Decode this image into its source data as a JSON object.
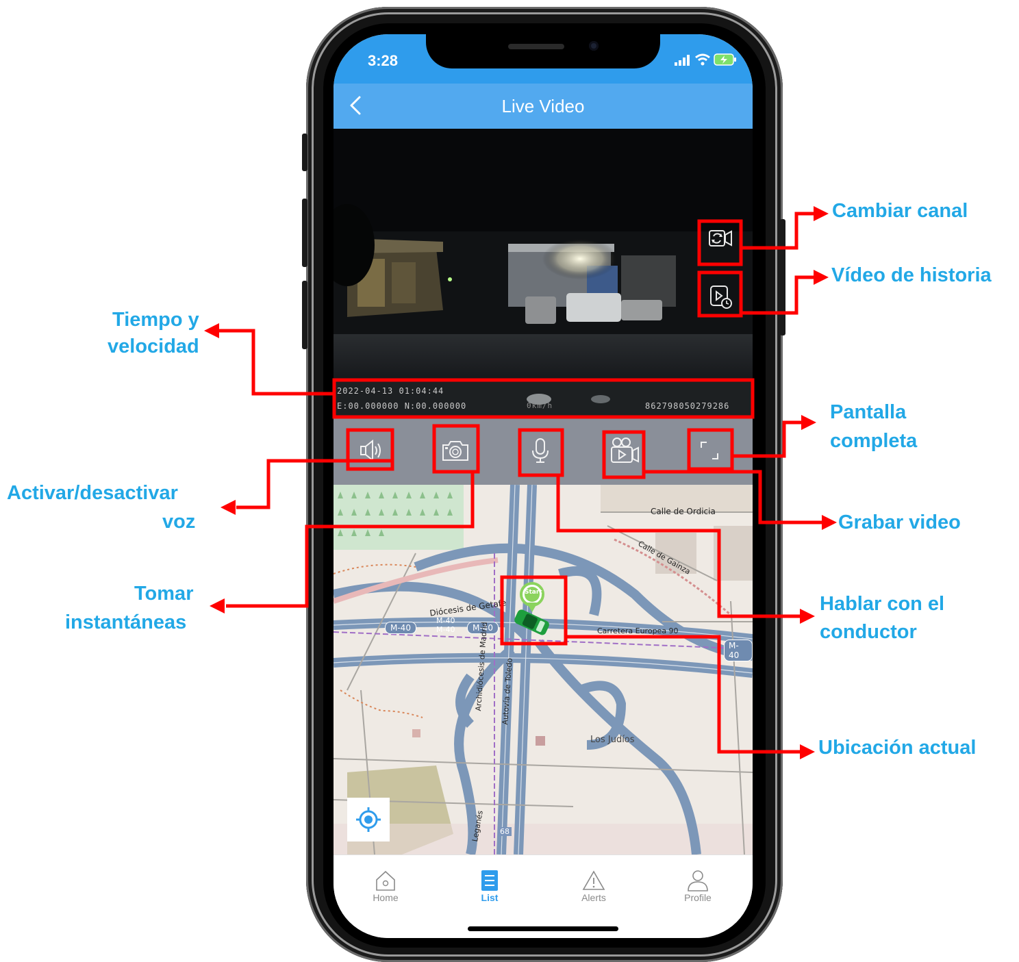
{
  "status_bar": {
    "time": "3:28"
  },
  "navbar": {
    "title": "Live Video"
  },
  "video": {
    "osd_datetime": "2022-04-13 01:04:44",
    "osd_coordinates": "E:00.000000 N:00.000000",
    "osd_speed": "0km/h",
    "osd_device_id": "862798050279286"
  },
  "controls": [
    "speaker-icon",
    "camera-icon",
    "microphone-icon",
    "record-video-icon",
    "fullscreen-icon"
  ],
  "map": {
    "labels": {
      "calle_ordicia": "Calle de Ordicia",
      "calle_gainza": "Calle de Gainza",
      "diocesis_getafe": "Diócesis de Getafe",
      "m40_a": "M-40",
      "m40_b": "M-40",
      "m40_c": "M-40",
      "m40_stack": "M-40",
      "m40_stack2": "M-40",
      "carretera": "Carretera Europea 90",
      "autovia_toledo": "Autovía de Toledo",
      "archidiocesis": "Archidiócesis de Madrid",
      "los_judios": "Los Judíos",
      "leganes": "Leganés",
      "route_68": "68",
      "start": "Start"
    }
  },
  "tabbar": {
    "tabs": [
      {
        "label": "Home",
        "icon": "home-icon"
      },
      {
        "label": "List",
        "icon": "list-icon"
      },
      {
        "label": "Alerts",
        "icon": "alert-icon"
      },
      {
        "label": "Profile",
        "icon": "profile-icon"
      }
    ]
  },
  "annotations": {
    "cambiar_canal": "Cambiar canal",
    "video_historia": "Vídeo de historia",
    "tiempo_1": "Tiempo y",
    "tiempo_2": "velocidad",
    "pantalla_1": "Pantalla",
    "pantalla_2": "completa",
    "voz_1": "Activar/desactivar",
    "voz_2": "voz",
    "grabar": "Grabar video",
    "tomar_1": "Tomar",
    "tomar_2": "instantáneas",
    "hablar_1": "Hablar con el",
    "hablar_2": "conductor",
    "ubicacion": "Ubicación actual"
  },
  "colors": {
    "accent": "#2f9cec",
    "annotation_text": "#22a8e6",
    "annotation_line": "#ff0000"
  }
}
